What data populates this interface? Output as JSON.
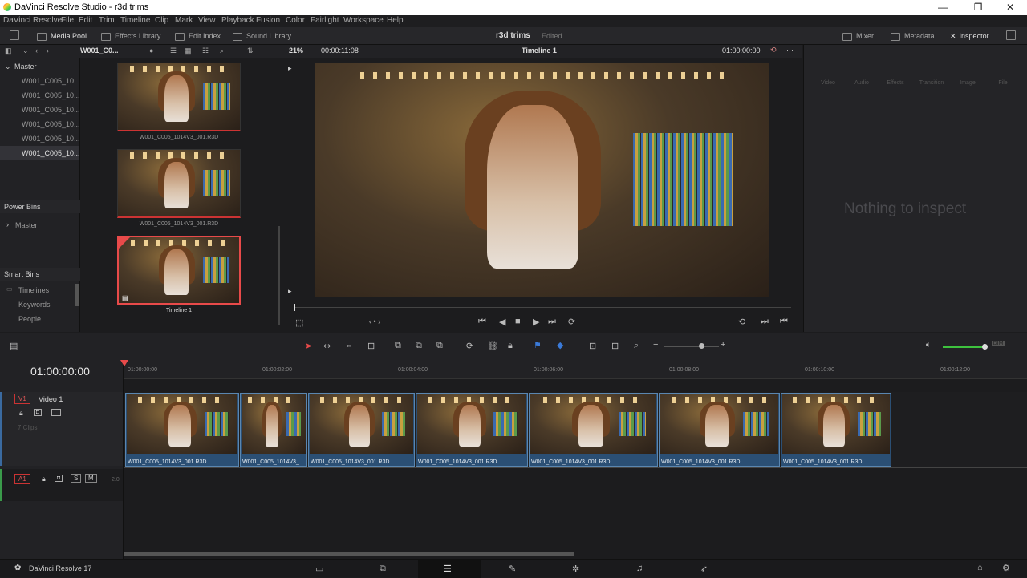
{
  "window": {
    "title": "DaVinci Resolve Studio - r3d trims",
    "minimize": "—",
    "maximize": "❐",
    "close": "✕"
  },
  "menu": [
    "DaVinci Resolve",
    "File",
    "Edit",
    "Trim",
    "Timeline",
    "Clip",
    "Mark",
    "View",
    "Playback",
    "Fusion",
    "Color",
    "Fairlight",
    "Workspace",
    "Help"
  ],
  "toolbar": {
    "media_pool": "Media Pool",
    "effects_library": "Effects Library",
    "edit_index": "Edit Index",
    "sound_library": "Sound Library",
    "project": "r3d trims",
    "status": "Edited",
    "mixer": "Mixer",
    "metadata": "Metadata",
    "inspector": "Inspector"
  },
  "subtoolbar": {
    "bin_name": "W001_C0...",
    "zoom": "21%",
    "timecode": "00:00:11:08",
    "timeline_name": "Timeline 1",
    "viewer_tc": "01:00:00:00"
  },
  "bins": {
    "master": "Master",
    "items": [
      "W001_C005_10...",
      "W001_C005_10...",
      "W001_C005_10...",
      "W001_C005_10...",
      "W001_C005_10...",
      "W001_C005_10..."
    ],
    "power_bins": "Power Bins",
    "power_master": "Master",
    "smart_bins": "Smart Bins",
    "smart_items": [
      "Timelines",
      "Keywords",
      "People"
    ]
  },
  "media": [
    {
      "caption": "W001_C005_1014V3_001.R3D"
    },
    {
      "caption": "W001_C005_1014V3_001.R3D"
    },
    {
      "caption": "Timeline 1"
    }
  ],
  "inspector": {
    "tabs": [
      "Video",
      "Audio",
      "Effects",
      "Transition",
      "Image",
      "File"
    ],
    "empty": "Nothing to inspect"
  },
  "timeline": {
    "timecode": "01:00:00:00",
    "ruler": [
      "01:00:00:00",
      "01:00:02:00",
      "01:00:04:00",
      "01:00:06:00",
      "01:00:08:00",
      "01:00:10:00",
      "01:00:12:00"
    ],
    "v1": "V1",
    "video_track": "Video 1",
    "clip_count": "7 Clips",
    "a1": "A1",
    "audio_level": "2.0",
    "s": "S",
    "m": "M",
    "clips": [
      "W001_C005_1014V3_001.R3D",
      "W001_C005_1014V3_...",
      "W001_C005_1014V3_001.R3D",
      "W001_C005_1014V3_001.R3D",
      "W001_C005_1014V3_001.R3D",
      "W001_C005_1014V3_001.R3D",
      "W001_C005_1014V3_001.R3D"
    ]
  },
  "bottom": {
    "app": "DaVinci Resolve 17"
  },
  "colors": {
    "accent": "#e84a4a",
    "clip": "#2b4f74",
    "volume": "#3ec23e"
  }
}
